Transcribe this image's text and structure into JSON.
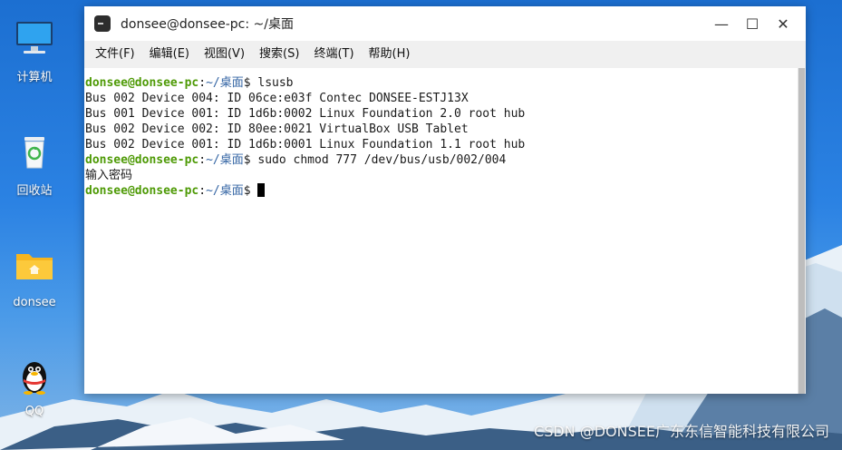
{
  "desktop": {
    "icons": [
      {
        "label": "计算机"
      },
      {
        "label": "回收站"
      },
      {
        "label": "donsee"
      },
      {
        "label": "QQ"
      }
    ]
  },
  "window": {
    "title": "donsee@donsee-pc: ~/桌面",
    "controls": {
      "minimize": "—",
      "maximize": "☐",
      "close": "✕"
    }
  },
  "menu": {
    "items": [
      "文件(F)",
      "编辑(E)",
      "视图(V)",
      "搜索(S)",
      "终端(T)",
      "帮助(H)"
    ]
  },
  "terminal": {
    "prompt_user": "donsee@donsee-pc",
    "prompt_colon": ":",
    "prompt_path": "~/桌面",
    "prompt_symbol": "$ ",
    "cmd1": "lsusb",
    "output": [
      "Bus 002 Device 004: ID 06ce:e03f Contec DONSEE-ESTJ13X",
      "Bus 001 Device 001: ID 1d6b:0002 Linux Foundation 2.0 root hub",
      "Bus 002 Device 002: ID 80ee:0021 VirtualBox USB Tablet",
      "Bus 002 Device 001: ID 1d6b:0001 Linux Foundation 1.1 root hub"
    ],
    "cmd2": "sudo chmod 777 /dev/bus/usb/002/004",
    "password_prompt": "输入密码"
  },
  "watermark": "CSDN @DONSEE广东东信智能科技有限公司",
  "colors": {
    "prompt_user": "#4e9a06",
    "prompt_path": "#3465a4"
  }
}
